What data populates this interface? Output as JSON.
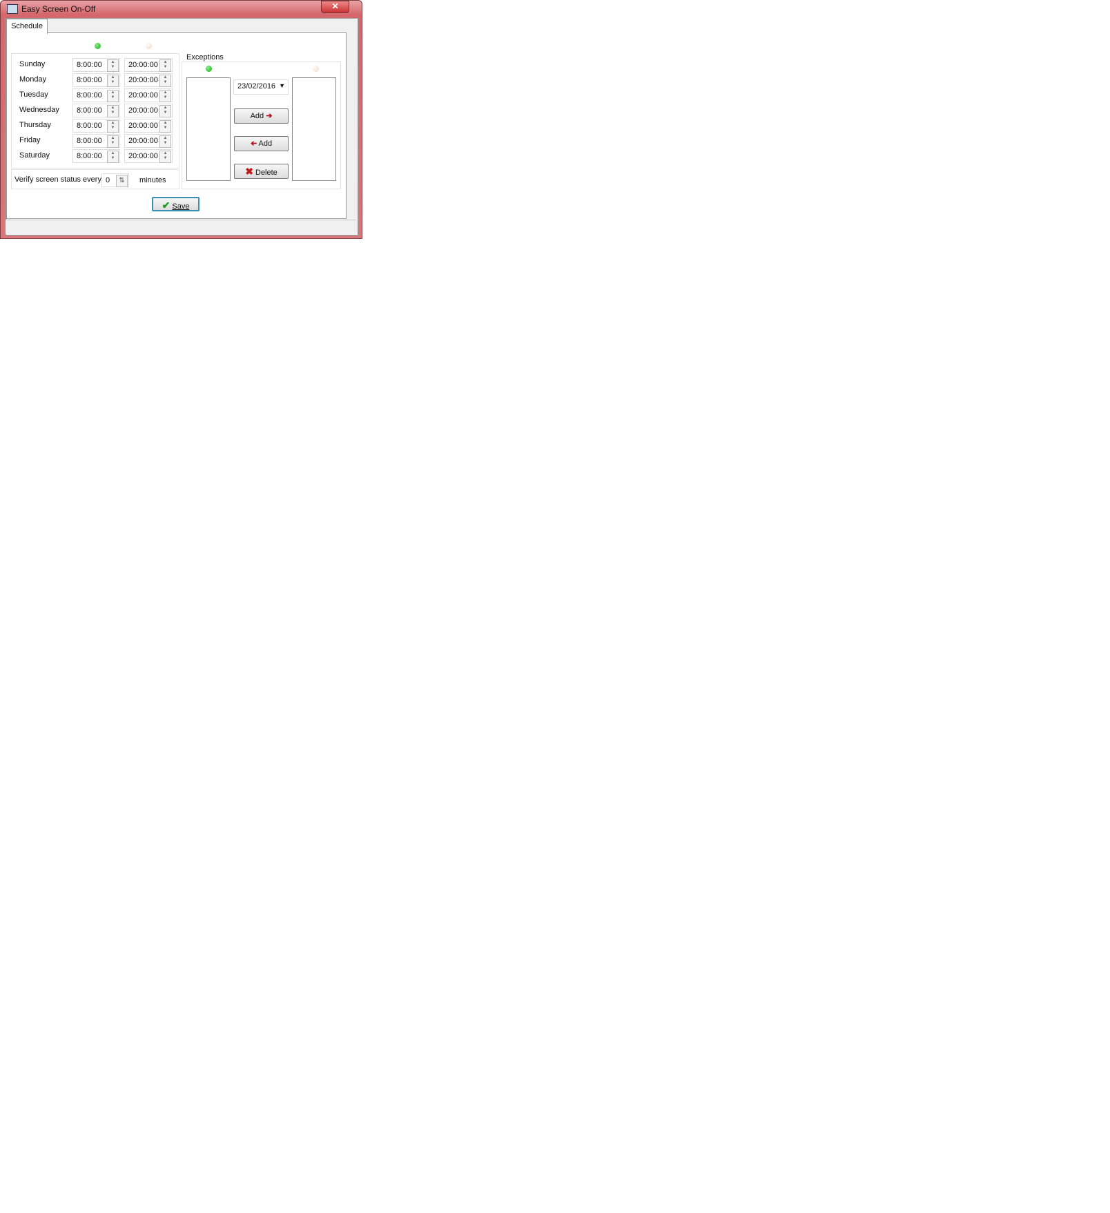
{
  "window": {
    "title": "Easy Screen On-Off",
    "close_label": "✕"
  },
  "tabs": [
    {
      "label": "Schedule",
      "active": true
    }
  ],
  "schedule": {
    "on_indicator_color": "#22aa22",
    "off_indicator_color": "#f3d3b8",
    "days": [
      {
        "day": "Sunday",
        "on": "8:00:00",
        "off": "20:00:00"
      },
      {
        "day": "Monday",
        "on": "8:00:00",
        "off": "20:00:00"
      },
      {
        "day": "Tuesday",
        "on": "8:00:00",
        "off": "20:00:00"
      },
      {
        "day": "Wednesday",
        "on": "8:00:00",
        "off": "20:00:00"
      },
      {
        "day": "Thursday",
        "on": "8:00:00",
        "off": "20:00:00"
      },
      {
        "day": "Friday",
        "on": "8:00:00",
        "off": "20:00:00"
      },
      {
        "day": "Saturday",
        "on": "8:00:00",
        "off": "20:00:00"
      }
    ],
    "verify_label": "Verify screen status every",
    "verify_value": "0",
    "verify_unit": "minutes"
  },
  "exceptions": {
    "title": "Exceptions",
    "date": "23/02/2016",
    "add_right": "Add",
    "add_left": "Add",
    "delete": "Delete",
    "on_list": [],
    "off_list": []
  },
  "save_label": "Save"
}
